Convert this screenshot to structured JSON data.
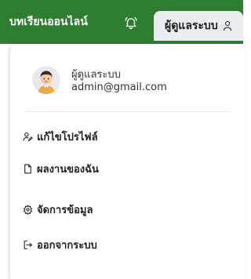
{
  "header": {
    "nav_link": "บทเรียนออนไลน์",
    "bell_icon": "bell-icon",
    "user_button_label": "ผู้ดูแลระบบ",
    "user_icon": "user-icon",
    "bar_color": "#2e7d32"
  },
  "dropdown": {
    "profile": {
      "name": "ผู้ดูแลระบบ",
      "email": "admin@gmail.com",
      "avatar": "avatar-illustration"
    },
    "items": [
      {
        "icon": "user-edit-icon",
        "label": "แก้ไขโปรไฟล์"
      },
      {
        "icon": "document-icon",
        "label": "ผลงานของฉัน"
      },
      {
        "icon": "gear-icon",
        "label": "จัดการข้อมูล"
      },
      {
        "icon": "logout-icon",
        "label": "ออกจากระบบ"
      }
    ]
  }
}
